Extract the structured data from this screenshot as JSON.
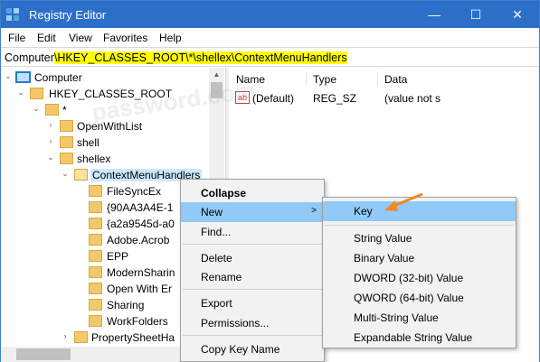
{
  "window": {
    "title": "Registry Editor",
    "minimize_glyph": "—",
    "maximize_glyph": "☐",
    "close_glyph": "✕"
  },
  "menu": {
    "file": "File",
    "edit": "Edit",
    "view": "View",
    "favorites": "Favorites",
    "help": "Help"
  },
  "address": {
    "prefix": "Computer",
    "highlighted": "\\HKEY_CLASSES_ROOT\\*\\shellex\\ContextMenuHandlers"
  },
  "tree": {
    "computer": "Computer",
    "hkcr": "HKEY_CLASSES_ROOT",
    "star": "*",
    "openwithlist": "OpenWithList",
    "shell": "shell",
    "shellex": "shellex",
    "cmh": "ContextMenuHandlers",
    "children": [
      "FileSyncEx",
      "{90AA3A4E-1",
      "{a2a9545d-a0",
      "Adobe.Acrob",
      "EPP",
      "ModernSharin",
      "Open With Er",
      "Sharing",
      "WorkFolders"
    ],
    "propertysheet": "PropertySheetHa"
  },
  "list": {
    "headers": {
      "name": "Name",
      "type": "Type",
      "data": "Data"
    },
    "row": {
      "name": "(Default)",
      "type": "REG_SZ",
      "data": "(value not s"
    },
    "icon_text": "ab"
  },
  "watermark": "password.com",
  "context_menu": {
    "collapse": "Collapse",
    "new": "New",
    "find": "Find...",
    "delete": "Delete",
    "rename": "Rename",
    "export": "Export",
    "permissions": "Permissions...",
    "copy_key_name": "Copy Key Name",
    "submenu_arrow": ">"
  },
  "new_submenu": {
    "key": "Key",
    "string_value": "String Value",
    "binary_value": "Binary Value",
    "dword": "DWORD (32-bit) Value",
    "qword": "QWORD (64-bit) Value",
    "multi_string": "Multi-String Value",
    "expandable": "Expandable String Value"
  },
  "colors": {
    "titlebar": "#2b6fc9",
    "highlight_address": "#ffff00",
    "menu_hover": "#91c9f7",
    "arrow": "#f08a24"
  },
  "icons": {
    "registry_app": "registry-icon",
    "folder": "folder-icon",
    "computer": "computer-icon",
    "string_value": "ab-icon",
    "pointer_arrow": "orange-arrow-icon"
  }
}
